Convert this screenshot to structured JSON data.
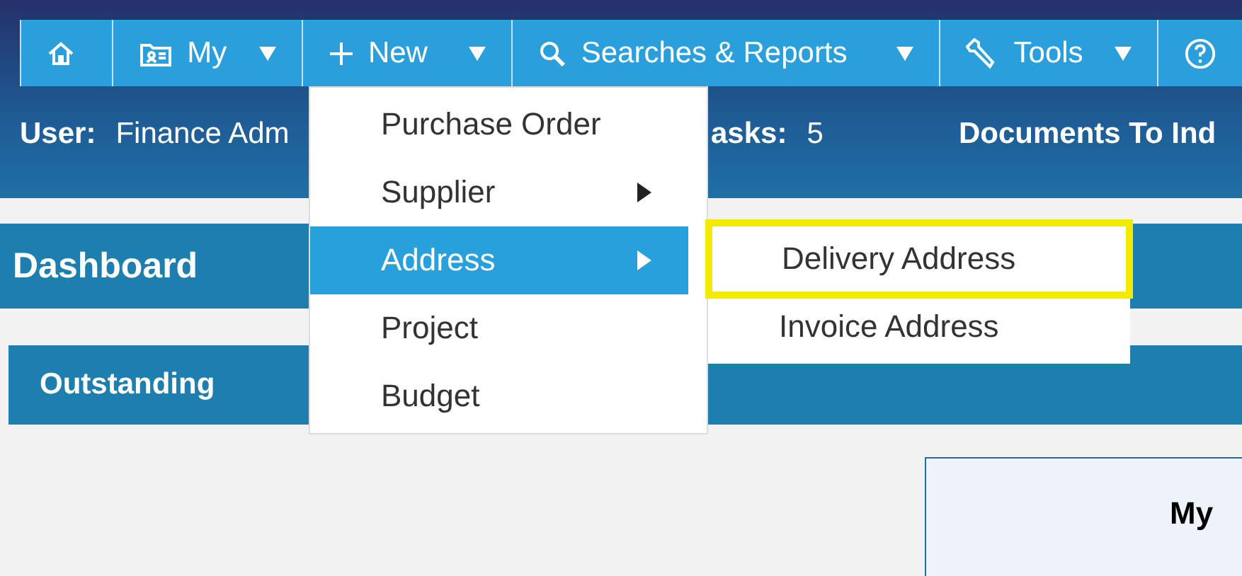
{
  "nav": [
    {
      "kind": "home",
      "caret": false
    },
    {
      "kind": "my",
      "label": "My",
      "caret": true
    },
    {
      "kind": "new",
      "label": "New",
      "caret": true
    },
    {
      "kind": "search",
      "label": "Searches & Reports",
      "caret": true
    },
    {
      "kind": "tools",
      "label": "Tools",
      "caret": true
    },
    {
      "kind": "help",
      "caret": false
    }
  ],
  "info": [
    {
      "label": "User:",
      "value": "Finance Adm"
    },
    {
      "label": "asks:",
      "value": "5"
    },
    {
      "label": "Documents To Ind"
    }
  ],
  "menu": {
    "items": [
      {
        "label": "Purchase Order",
        "selected": false,
        "submenu": false
      },
      {
        "label": "Supplier",
        "selected": false,
        "submenu": true
      },
      {
        "label": "Address",
        "selected": true,
        "submenu": true
      },
      {
        "label": "Project",
        "selected": false,
        "submenu": false
      },
      {
        "label": "Budget",
        "selected": false,
        "submenu": false
      }
    ]
  },
  "submenu": {
    "items": [
      {
        "label": "Delivery Address",
        "highlighted": true
      },
      {
        "label": "Invoice Address",
        "highlighted": false
      }
    ]
  },
  "dashboard": {
    "title": "Dashboard"
  },
  "section": {
    "title": "Outstanding"
  },
  "card": {
    "title": "My"
  }
}
